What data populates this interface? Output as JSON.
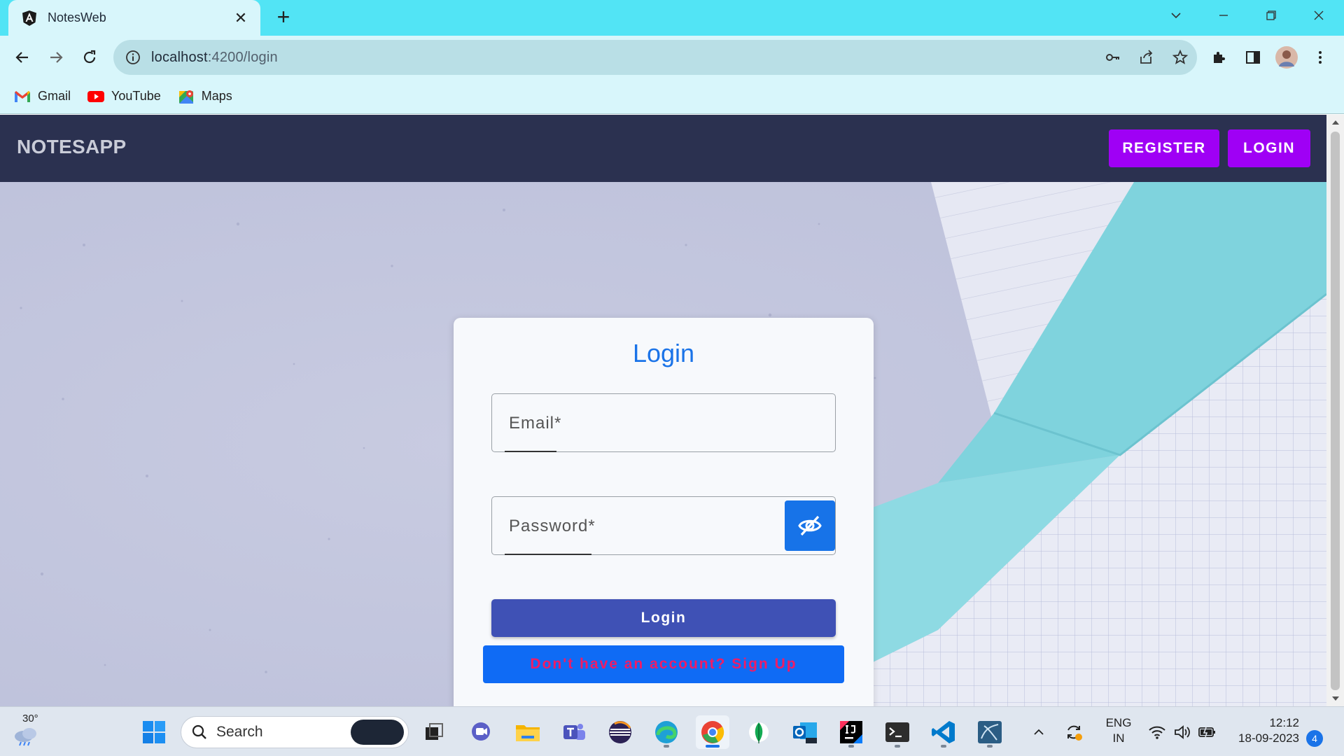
{
  "browser": {
    "tab_title": "NotesWeb",
    "url_host": "localhost",
    "url_rest": ":4200/login",
    "bookmarks": [
      {
        "label": "Gmail",
        "icon": "gmail-icon"
      },
      {
        "label": "YouTube",
        "icon": "youtube-icon"
      },
      {
        "label": "Maps",
        "icon": "maps-icon"
      }
    ]
  },
  "app": {
    "brand": "NOTESAPP",
    "nav": {
      "register_label": "REGISTER",
      "login_label": "LOGIN"
    },
    "colors": {
      "navbar": "#2b3150",
      "nav_button": "#9f00f5",
      "accent": "#1a73e8",
      "primary_button": "#3f51b5",
      "signup_button": "#0f6bf5",
      "signup_text": "#ef1c66"
    }
  },
  "login_form": {
    "title": "Login",
    "email_placeholder": "Email*",
    "password_placeholder": "Password*",
    "visibility_icon": "eye-off-icon",
    "submit_label": "Login",
    "signup_label": "Don't have an account? Sign Up"
  },
  "taskbar": {
    "weather_temp": "30°",
    "search_label": "Search",
    "language_line1": "ENG",
    "language_line2": "IN",
    "time": "12:12",
    "date": "18-09-2023",
    "notification_count": "4"
  }
}
